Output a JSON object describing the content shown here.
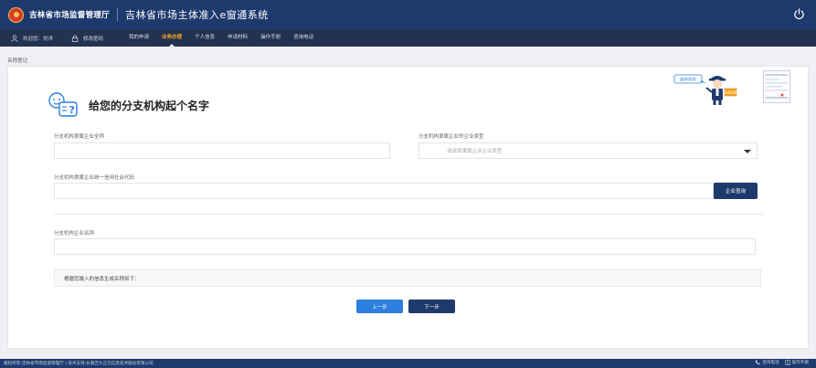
{
  "header": {
    "org_name": "吉林省市场监督管理厅",
    "system_title": "吉林省市场主体准入e窗通系统"
  },
  "nav": {
    "welcome": "欢迎您：刘洋",
    "change_password": "修改密码",
    "items": [
      {
        "label": "我的申请"
      },
      {
        "label": "业务办理",
        "active": true
      },
      {
        "label": "个人信息"
      },
      {
        "label": "申请材料"
      },
      {
        "label": "操作手册"
      },
      {
        "label": "咨询电话"
      }
    ]
  },
  "breadcrumb": "名称登记",
  "form": {
    "heading": "给您的分支机构起个名字",
    "parent_name_label": "分支机构隶属企业全称",
    "parent_name_value": "",
    "parent_type_label": "分支机构隶属企业的企业类型",
    "parent_type_placeholder": "请选择隶属企业企业类型",
    "credit_code_label": "分支机构隶属企业统一信用社会代码",
    "credit_code_value": "",
    "query_button": "企业查询",
    "branch_name_label": "分支机构企业名称",
    "branch_name_value": "",
    "notice_text": "根据您输入的信息生成名称如下：",
    "prev_button": "上一步",
    "next_button": "下一步"
  },
  "mascot": {
    "bubble_text": "操作向导",
    "sign_text": "业务办理"
  },
  "footer": {
    "copyright": "版权所有:吉林省市场监督管理厅 | 技术支持:长春吉大正元信息技术股份有限公司",
    "hotline": "咨询电话",
    "manual": "操作手册"
  },
  "colors": {
    "header_bg": "#1e3a6d",
    "nav_bg": "#233251",
    "nav_active": "#f5a623",
    "prev_btn": "#2d7fe0"
  }
}
